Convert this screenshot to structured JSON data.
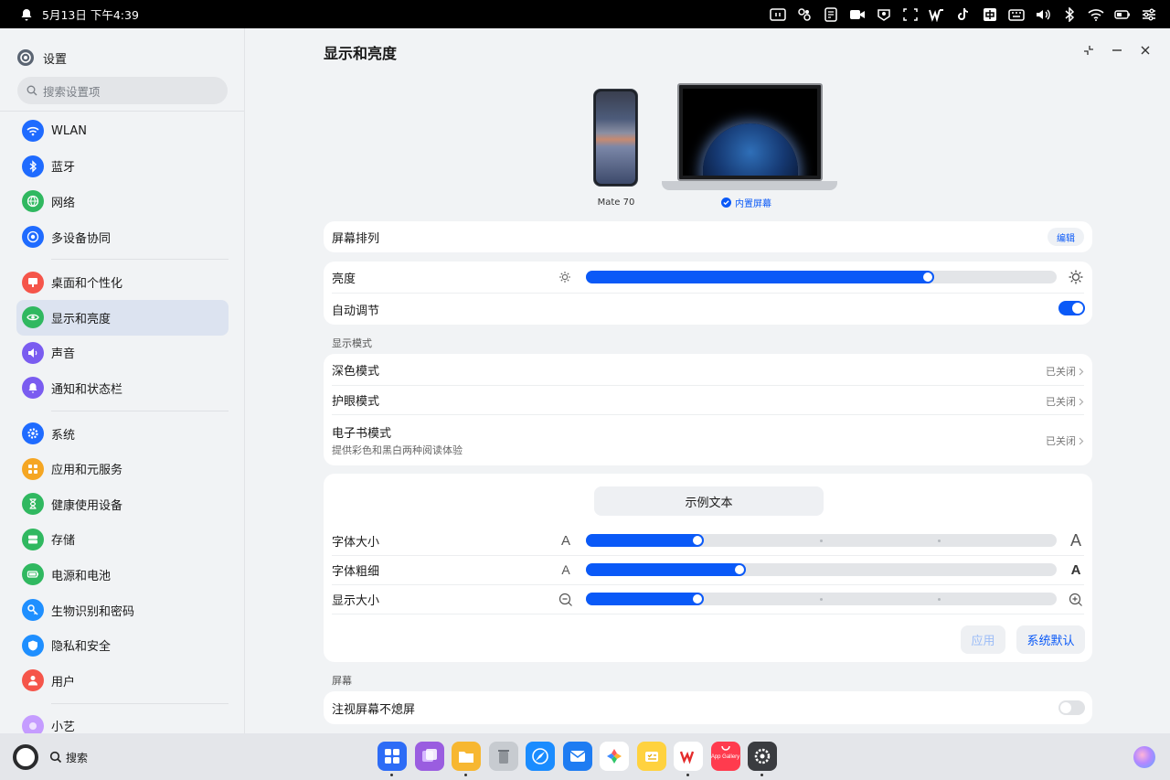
{
  "status_bar": {
    "datetime": "5月13日 下午4:39",
    "icons": [
      "notification-bell-icon",
      "screen-projection-icon",
      "multi-window-icon",
      "notes-icon",
      "screen-record-icon",
      "screenshot-icon",
      "region-select-icon",
      "wps-icon",
      "tiktok-icon",
      "ime-icon",
      "keyboard-icon",
      "volume-icon",
      "bluetooth-icon",
      "wifi-icon",
      "battery-icon",
      "control-panel-icon"
    ]
  },
  "sidebar": {
    "app_title": "设置",
    "search_placeholder": "搜索设置项",
    "groups": [
      [
        {
          "label": "WLAN",
          "icon": "wifi-icon",
          "color": "#1f6bff"
        },
        {
          "label": "蓝牙",
          "icon": "bluetooth-icon",
          "color": "#1f6bff"
        },
        {
          "label": "网络",
          "icon": "network-icon",
          "color": "#30b860"
        },
        {
          "label": "多设备协同",
          "icon": "multi-device-icon",
          "color": "#1f6bff"
        }
      ],
      [
        {
          "label": "桌面和个性化",
          "icon": "desktop-icon",
          "color": "#f5554a"
        },
        {
          "label": "显示和亮度",
          "icon": "eye-icon",
          "color": "#30b860",
          "active": true
        },
        {
          "label": "声音",
          "icon": "sound-icon",
          "color": "#7a5cf0"
        },
        {
          "label": "通知和状态栏",
          "icon": "bell-icon",
          "color": "#7a5cf0"
        }
      ],
      [
        {
          "label": "系统",
          "icon": "system-gear-icon",
          "color": "#1f6bff"
        },
        {
          "label": "应用和元服务",
          "icon": "apps-icon",
          "color": "#f5a623"
        },
        {
          "label": "健康使用设备",
          "icon": "hourglass-icon",
          "color": "#30b860"
        },
        {
          "label": "存储",
          "icon": "storage-icon",
          "color": "#30b860"
        },
        {
          "label": "电源和电池",
          "icon": "battery-icon",
          "color": "#30b860"
        },
        {
          "label": "生物识别和密码",
          "icon": "key-icon",
          "color": "#1f8fff"
        },
        {
          "label": "隐私和安全",
          "icon": "privacy-icon",
          "color": "#1f8fff"
        },
        {
          "label": "用户",
          "icon": "user-icon",
          "color": "#f5554a"
        }
      ],
      [
        {
          "label": "小艺",
          "icon": "xiaoyi-icon",
          "color": "#c59cff"
        }
      ]
    ]
  },
  "main": {
    "title": "显示和亮度",
    "devices": {
      "phone_label": "Mate 70",
      "builtin_label": "内置屏幕"
    },
    "arrangement": {
      "label": "屏幕排列",
      "edit_label": "编辑"
    },
    "brightness": {
      "label": "亮度",
      "value_fraction": 0.74
    },
    "auto_adjust": {
      "label": "自动调节",
      "enabled": true
    },
    "display_mode_header": "显示模式",
    "display_modes": [
      {
        "label": "深色模式",
        "status": "已关闭"
      },
      {
        "label": "护眼模式",
        "status": "已关闭"
      },
      {
        "label": "电子书模式",
        "subtitle": "提供彩色和黑白两种阅读体验",
        "status": "已关闭"
      }
    ],
    "text": {
      "sample_label": "示例文本",
      "font_size": {
        "label": "字体大小",
        "value_fraction": 0.25
      },
      "font_weight": {
        "label": "字体粗细",
        "value_fraction": 0.34
      },
      "display_size": {
        "label": "显示大小",
        "value_fraction": 0.25
      },
      "apply_label": "应用",
      "default_label": "系统默认"
    },
    "screen_header": "屏幕",
    "gaze_keep_on": {
      "label": "注视屏幕不熄屏",
      "enabled": false
    }
  },
  "dock": {
    "search_label": "搜索",
    "apps": [
      {
        "name": "app-center-icon",
        "color": "#2d6cf6",
        "dot": true
      },
      {
        "name": "multi-window-app-icon",
        "color": "#9a5de0",
        "dot": false
      },
      {
        "name": "files-icon",
        "color": "#f7b731",
        "dot": true
      },
      {
        "name": "trash-icon",
        "color": "#c7cbd0",
        "dot": false
      },
      {
        "name": "browser-icon",
        "color": "#1a8cff",
        "dot": false
      },
      {
        "name": "mail-icon",
        "color": "#1e7cf2",
        "dot": false
      },
      {
        "name": "gallery-icon",
        "color": "#ffffff",
        "dot": false
      },
      {
        "name": "notes-app-icon",
        "color": "#ffd23f",
        "dot": false
      },
      {
        "name": "wps-app-icon",
        "color": "#ffffff",
        "dot": true
      },
      {
        "name": "app-gallery-icon",
        "color": "#ff3b4e",
        "dot": false
      },
      {
        "name": "settings-app-icon",
        "color": "#3a3c40",
        "dot": true
      }
    ],
    "app_gallery_label": "App Gallery"
  }
}
